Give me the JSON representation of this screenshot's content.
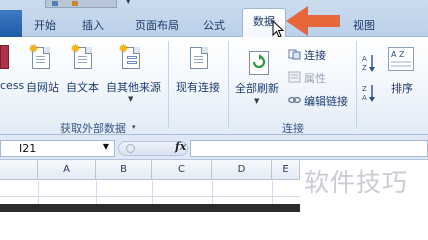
{
  "tabs": [
    {
      "label": "开始"
    },
    {
      "label": "插入"
    },
    {
      "label": "页面布局"
    },
    {
      "label": "公式"
    },
    {
      "label": "数据",
      "active": true
    },
    {
      "label": "视图"
    }
  ],
  "ribbon": {
    "get_external": {
      "access_label": "cess",
      "web_label": "自网站",
      "text_label": "自文本",
      "other_label": "自其他来源",
      "existing_label": "现有连接",
      "group_label": "获取外部数据"
    },
    "connections": {
      "refresh_all_label": "全部刷新",
      "connections_label": "连接",
      "properties_label": "属性",
      "edit_links_label": "编辑链接",
      "group_label": "连接"
    },
    "sort": {
      "az_label": "A Z",
      "sort_label": "排序"
    }
  },
  "formula_bar": {
    "name_box": "I21",
    "fx": "fx"
  },
  "columns": [
    "A",
    "B",
    "C",
    "D",
    "E"
  ],
  "watermark": "软件技巧",
  "colors": {
    "accent_arrow": "#e8673a",
    "ribbon_blue": "#1e3c6e"
  }
}
